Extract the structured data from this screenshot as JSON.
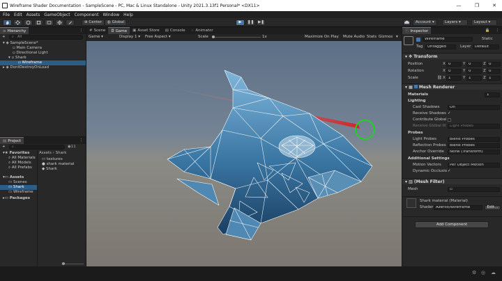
{
  "titlebar": {
    "title": "Wireframe Shader Documentation - SampleScene - PC, Mac & Linux Standalone - Unity 2021.3.13f1 Personal* <DX11>",
    "minimize": "—",
    "maximize": "❐",
    "close": "✕"
  },
  "menu": [
    "File",
    "Edit",
    "Assets",
    "GameObject",
    "Component",
    "Window",
    "Help"
  ],
  "toolbar": {
    "center_label": "Center",
    "global_label": "Global",
    "play": "▶",
    "pause": "❚❚",
    "step": "▶❚",
    "account_label": "Account",
    "layers_label": "Layers",
    "layout_label": "Layout",
    "cloud_icon": "cloud-icon"
  },
  "hierarchy": {
    "tab_label": "Hierarchy",
    "add_label": "+",
    "search_placeholder": "All",
    "items": [
      {
        "label": "SampleScene*",
        "indent": 0
      },
      {
        "label": "Main Camera",
        "indent": 2
      },
      {
        "label": "Directional Light",
        "indent": 2
      },
      {
        "label": "Shark",
        "indent": 2
      },
      {
        "label": "Wireframe",
        "indent": 3
      },
      {
        "label": "DontDestroyOnLoad",
        "indent": 1
      }
    ]
  },
  "project": {
    "tab_label": "Project",
    "add_label": "+",
    "tree": [
      {
        "label": "Favorites",
        "bold": true,
        "indent": 0
      },
      {
        "label": "All Materials",
        "bold": false,
        "indent": 1
      },
      {
        "label": "All Models",
        "bold": false,
        "indent": 1
      },
      {
        "label": "All Prefabs",
        "bold": false,
        "indent": 1
      },
      {
        "label": "Assets",
        "bold": true,
        "indent": 0
      },
      {
        "label": "Scenes",
        "bold": false,
        "indent": 1
      },
      {
        "label": "Shark",
        "bold": false,
        "indent": 1
      },
      {
        "label": "Wireframe",
        "bold": false,
        "indent": 1
      },
      {
        "label": "Packages",
        "bold": true,
        "indent": 0
      }
    ],
    "breadcrumb": [
      "Assets",
      "Shark"
    ],
    "files": [
      "textures",
      "shark material",
      "Shark"
    ],
    "count_label": "11"
  },
  "scene_tabs": {
    "tabs": [
      "Scene",
      "Game",
      "Asset Store",
      "Console",
      "Animator"
    ],
    "selected": "Game",
    "display_label": "Game",
    "display_select": "Display 1",
    "aspect_select": "Free Aspect",
    "scale_label": "Scale",
    "scale_value": "1x",
    "maximize_label": "Maximize On Play",
    "mute_label": "Mute Audio",
    "stats_label": "Stats",
    "gizmos_label": "Gizmos"
  },
  "inspector": {
    "tab_label": "Inspector",
    "object_name": "Wireframe",
    "static_label": "Static",
    "tag_label": "Tag",
    "tag_value": "Untagged",
    "layer_label": "Layer",
    "layer_value": "Default",
    "transform": {
      "title": "Transform",
      "rows": [
        {
          "label": "Position",
          "x": "0",
          "y": "0",
          "z": "0"
        },
        {
          "label": "Rotation",
          "x": "0",
          "y": "0",
          "z": "0"
        },
        {
          "label": "Scale",
          "x": "1",
          "y": "1",
          "z": "1"
        }
      ]
    },
    "mesh_renderer": {
      "title": "Mesh Renderer",
      "materials_label": "Materials",
      "materials_count": "1",
      "lighting_label": "Lighting",
      "cast_shadows_label": "Cast Shadows",
      "cast_shadows_value": "On",
      "receive_shadows_label": "Receive Shadows",
      "contribute_gi_label": "Contribute Global",
      "receive_gi_label": "Receive Global Ill",
      "receive_gi_value": "Light Probes",
      "probes_label": "Probes",
      "light_probes_label": "Light Probes",
      "light_probes_value": "Blend Probes",
      "reflection_probes_label": "Reflection Probes",
      "reflection_probes_value": "Blend Probes",
      "anchor_override_label": "Anchor Override",
      "anchor_override_value": "None (Transform)",
      "additional_label": "Additional Settings",
      "motion_vectors_label": "Motion Vectors",
      "motion_vectors_value": "Per Object Motion",
      "dynamic_occlusion_label": "Dynamic Occlusio"
    },
    "mesh_filter": {
      "title": "(Mesh Filter)",
      "mesh_label": "Mesh"
    },
    "material": {
      "name": "Shark material (Material)",
      "shader_label": "Shader",
      "shader_value": "Azerilo/Wireframe",
      "edit_label": "Edit..."
    },
    "add_component_label": "Add Component"
  }
}
